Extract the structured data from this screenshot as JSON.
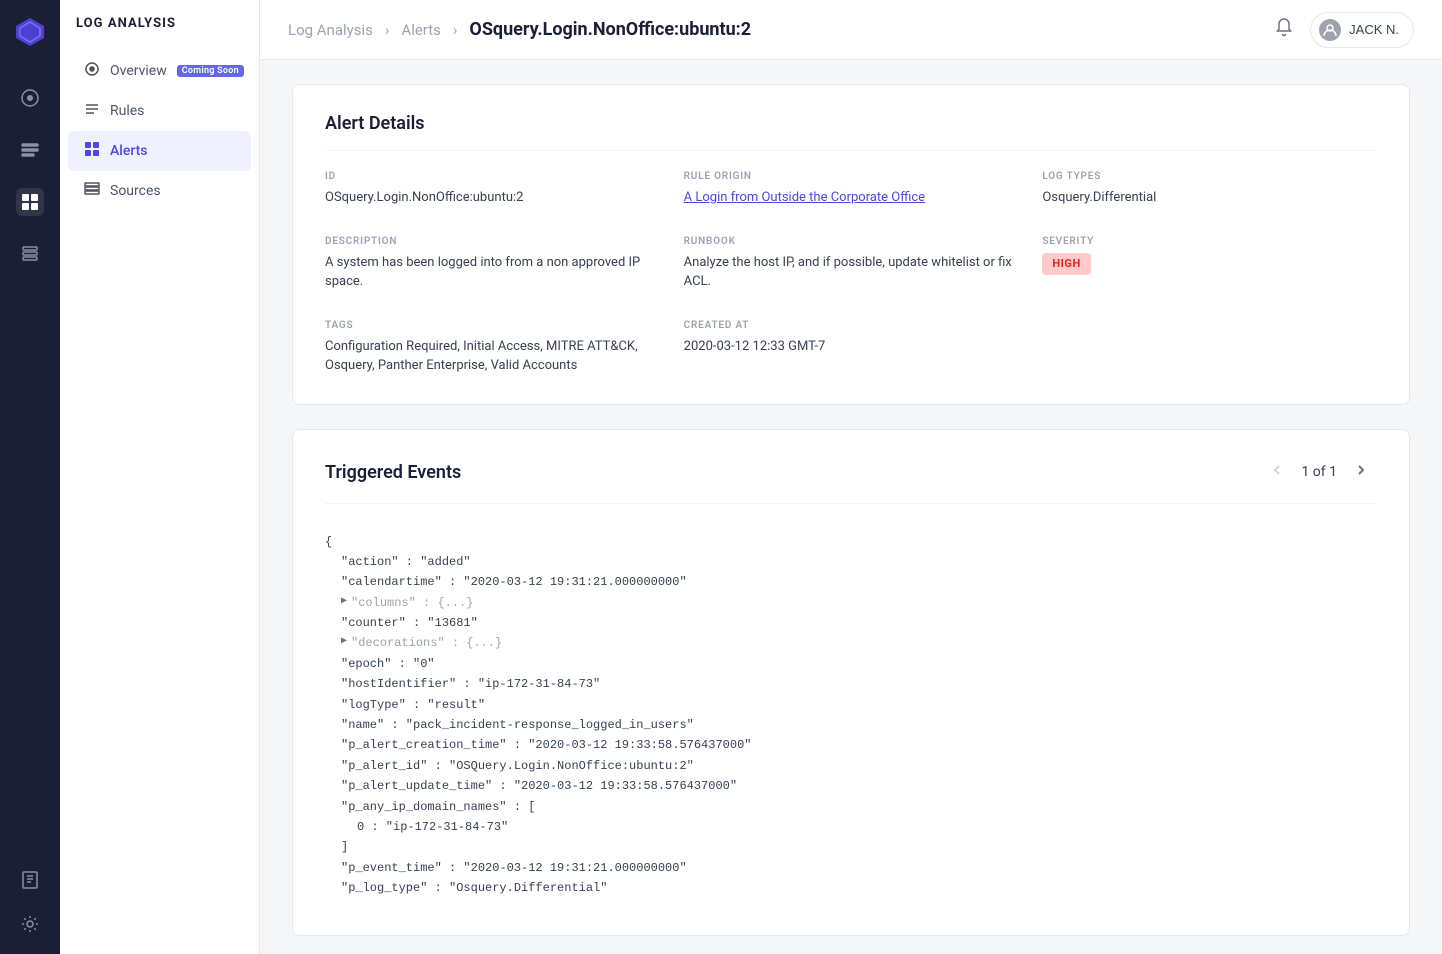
{
  "app": {
    "title": "LOG ANALYSIS"
  },
  "sidebar": {
    "icons": [
      {
        "name": "overview-icon",
        "symbol": "◎",
        "active": false
      },
      {
        "name": "rules-icon",
        "symbol": "☰",
        "active": false
      },
      {
        "name": "alerts-icon",
        "symbol": "⊞",
        "active": true
      },
      {
        "name": "sources-icon",
        "symbol": "≡",
        "active": false
      }
    ],
    "bottom_icons": [
      {
        "name": "book-icon",
        "symbol": "📖"
      },
      {
        "name": "settings-icon",
        "symbol": "⚙"
      }
    ]
  },
  "nav": {
    "items": [
      {
        "label": "Overview",
        "badge": "Coming Soon",
        "active": false,
        "name": "overview"
      },
      {
        "label": "Rules",
        "badge": "",
        "active": false,
        "name": "rules"
      },
      {
        "label": "Alerts",
        "badge": "",
        "active": true,
        "name": "alerts"
      },
      {
        "label": "Sources",
        "badge": "",
        "active": false,
        "name": "sources"
      }
    ]
  },
  "breadcrumb": {
    "items": [
      "Log Analysis",
      "Alerts"
    ],
    "current": "OSquery.Login.NonOffice:ubuntu:2"
  },
  "topbar": {
    "user": "JACK N."
  },
  "alert_details": {
    "title": "Alert Details",
    "id_label": "ID",
    "id_value": "OSquery.Login.NonOffice:ubuntu:2",
    "rule_origin_label": "RULE ORIGIN",
    "rule_origin_value": "A Login from Outside the Corporate Office",
    "log_types_label": "LOG TYPES",
    "log_types_value": "Osquery.Differential",
    "description_label": "DESCRIPTION",
    "description_value": "A system has been logged into from a non approved IP space.",
    "runbook_label": "RUNBOOK",
    "runbook_value": "Analyze the host IP, and if possible, update whitelist or fix ACL.",
    "severity_label": "SEVERITY",
    "severity_value": "HIGH",
    "tags_label": "TAGS",
    "tags_value": "Configuration Required, Initial Access, MITRE ATT&CK, Osquery, Panther Enterprise, Valid Accounts",
    "created_at_label": "CREATED AT",
    "created_at_value": "2020-03-12 12:33 GMT-7"
  },
  "triggered_events": {
    "title": "Triggered Events",
    "pagination": {
      "current": "1",
      "total": "1",
      "label": "1 of 1"
    },
    "json": [
      {
        "indent": 0,
        "content": "{",
        "type": "brace"
      },
      {
        "indent": 1,
        "content": "\"action\" : \"added\"",
        "type": "line"
      },
      {
        "indent": 1,
        "content": "\"calendartime\" : \"2020-03-12 19:31:21.000000000\"",
        "type": "line"
      },
      {
        "indent": 1,
        "content": "\"columns\" : {...}",
        "type": "collapsed",
        "toggle": true
      },
      {
        "indent": 1,
        "content": "\"counter\" : \"13681\"",
        "type": "line"
      },
      {
        "indent": 1,
        "content": "\"decorations\" : {...}",
        "type": "collapsed",
        "toggle": true
      },
      {
        "indent": 1,
        "content": "\"epoch\" : \"0\"",
        "type": "line"
      },
      {
        "indent": 1,
        "content": "\"hostIdentifier\" : \"ip-172-31-84-73\"",
        "type": "line"
      },
      {
        "indent": 1,
        "content": "\"logType\" : \"result\"",
        "type": "line"
      },
      {
        "indent": 1,
        "content": "\"name\" : \"pack_incident-response_logged_in_users\"",
        "type": "line"
      },
      {
        "indent": 1,
        "content": "\"p_alert_creation_time\" : \"2020-03-12 19:33:58.576437000\"",
        "type": "line"
      },
      {
        "indent": 1,
        "content": "\"p_alert_id\" : \"OSQuery.Login.NonOffice:ubuntu:2\"",
        "type": "line"
      },
      {
        "indent": 1,
        "content": "\"p_alert_update_time\" : \"2020-03-12 19:33:58.576437000\"",
        "type": "line"
      },
      {
        "indent": 1,
        "content": "\"p_any_ip_domain_names\" : [",
        "type": "line"
      },
      {
        "indent": 2,
        "content": "0 : \"ip-172-31-84-73\"",
        "type": "line"
      },
      {
        "indent": 1,
        "content": "]",
        "type": "line"
      },
      {
        "indent": 1,
        "content": "\"p_event_time\" : \"2020-03-12 19:31:21.000000000\"",
        "type": "line"
      },
      {
        "indent": 1,
        "content": "\"p_log_type\" : \"Osquery.Differential\"",
        "type": "line"
      }
    ]
  }
}
